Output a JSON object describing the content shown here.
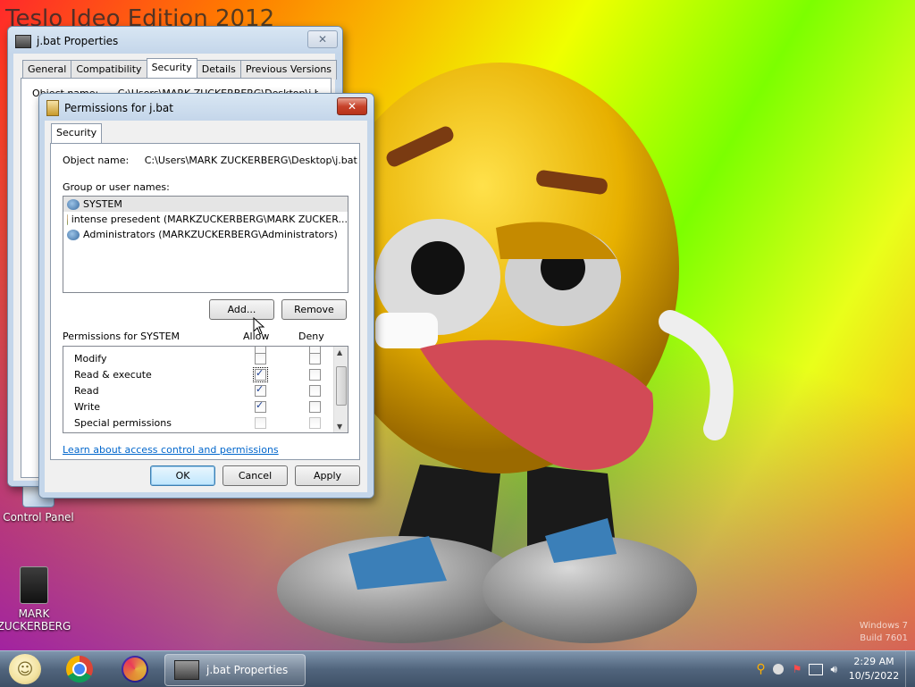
{
  "desktop": {
    "banner_text": "Teslo Ideo Edition 2012",
    "icons": [
      {
        "label": "Control Panel"
      },
      {
        "label": "MARK ZUCKERBERG"
      }
    ],
    "watermark_line1": "Windows 7",
    "watermark_line2": "Build 7601"
  },
  "properties_window": {
    "title": "j.bat Properties",
    "tabs": [
      "General",
      "Compatibility",
      "Security",
      "Details",
      "Previous Versions"
    ],
    "active_tab": "Security",
    "object_label_partial": "Object name:",
    "object_value_partial": "C:\\Users\\MARK ZUCKERBERG\\Desktop\\j.bat"
  },
  "permissions_dialog": {
    "title": "Permissions for j.bat",
    "tab": "Security",
    "object_name_label": "Object name:",
    "object_name_value": "C:\\Users\\MARK ZUCKERBERG\\Desktop\\j.bat",
    "group_label": "Group or user names:",
    "users": [
      {
        "name": "SYSTEM",
        "icon": "group-users-icon",
        "selected": true
      },
      {
        "name": "intense presedent (MARKZUCKERBERG\\MARK ZUCKER...",
        "icon": "user-icon",
        "selected": false
      },
      {
        "name": "Administrators (MARKZUCKERBERG\\Administrators)",
        "icon": "group-users-icon",
        "selected": false
      }
    ],
    "add_label": "Add...",
    "remove_label": "Remove",
    "permissions_for_label": "Permissions for SYSTEM",
    "allow_label": "Allow",
    "deny_label": "Deny",
    "permissions": [
      {
        "name": "Modify",
        "allow": false,
        "deny": false,
        "disabled": false
      },
      {
        "name": "Read & execute",
        "allow": true,
        "deny": false,
        "disabled": false
      },
      {
        "name": "Read",
        "allow": true,
        "deny": false,
        "disabled": false
      },
      {
        "name": "Write",
        "allow": true,
        "deny": false,
        "disabled": false
      },
      {
        "name": "Special permissions",
        "allow": false,
        "deny": false,
        "disabled": true
      }
    ],
    "learn_link": "Learn about access control and permissions",
    "ok_label": "OK",
    "cancel_label": "Cancel",
    "apply_label": "Apply"
  },
  "taskbar": {
    "apps": [
      {
        "name": "start",
        "icon": "start-orb-smiley-icon"
      },
      {
        "name": "chrome",
        "icon": "chrome-icon"
      },
      {
        "name": "firefox",
        "icon": "firefox-icon"
      }
    ],
    "window_button": "j.bat Properties",
    "time": "2:29 AM",
    "date": "10/5/2022"
  },
  "colors": {
    "accent": "#3c7fb1",
    "link": "#0066cc",
    "close": "#c7432b"
  }
}
